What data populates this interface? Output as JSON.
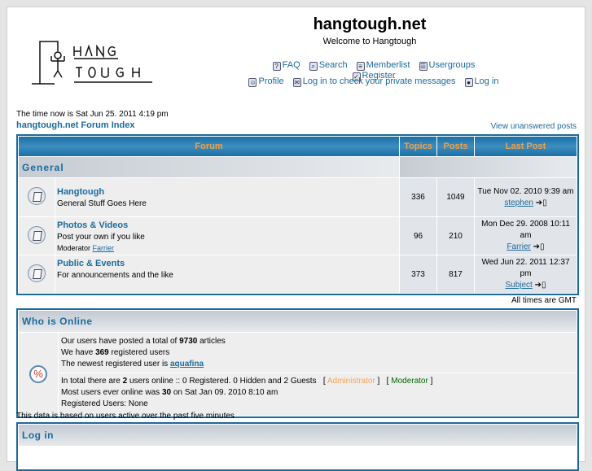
{
  "header": {
    "title": "hangtough.net",
    "subtitle": "Welcome to Hangtough",
    "logo_text": "HANG TOUGH"
  },
  "nav": {
    "row1": [
      {
        "icon": "faq-icon",
        "label": "FAQ"
      },
      {
        "icon": "search-icon",
        "label": "Search"
      },
      {
        "icon": "memberlist-icon",
        "label": "Memberlist"
      },
      {
        "icon": "usergroups-icon",
        "label": "Usergroups"
      },
      {
        "icon": "register-icon",
        "label": "Register"
      }
    ],
    "row2": [
      {
        "icon": "profile-icon",
        "label": "Profile"
      },
      {
        "icon": "messages-icon",
        "label": "Log in to check your private messages"
      },
      {
        "icon": "login-icon",
        "label": "Log in"
      }
    ]
  },
  "time_now": "The time now is Sat Jun 25. 2011 4:19 pm",
  "breadcrumb": "hangtough.net Forum Index",
  "view_unanswered": "View unanswered posts",
  "table": {
    "headers": [
      "Forum",
      "Topics",
      "Posts",
      "Last Post"
    ],
    "category": "General",
    "forums": [
      {
        "name": "Hangtough",
        "desc": "General Stuff Goes Here",
        "moderator_label": "",
        "moderator": "",
        "topics": "336",
        "posts": "1049",
        "last_date": "Tue Nov 02. 2010 9:39 am",
        "last_user": "stephen"
      },
      {
        "name": "Photos & Videos",
        "desc": "Post your own if you like",
        "moderator_label": "Moderator",
        "moderator": "Farrier",
        "topics": "96",
        "posts": "210",
        "last_date": "Mon Dec 29. 2008 10:11 am",
        "last_user": "Farrier"
      },
      {
        "name": "Public & Events",
        "desc": "For announcements and the like",
        "moderator_label": "",
        "moderator": "",
        "topics": "373",
        "posts": "817",
        "last_date": "Wed Jun 22. 2011 12:37 pm",
        "last_user": "Subject"
      }
    ]
  },
  "all_times": "All times are GMT",
  "online": {
    "title": "Who is Online",
    "l1a": "Our users have posted a total of ",
    "l1b": "9730",
    "l1c": " articles",
    "l2a": "We have ",
    "l2b": "369",
    "l2c": " registered users",
    "l3a": "The newest registered user is ",
    "l3b": "aquafina",
    "l4a": "In total there are ",
    "l4b": "2",
    "l4c": " users online :: 0 Registered. 0 Hidden and 2 Guests",
    "admin": "Administrator",
    "mod": "Moderator",
    "l5a": "Most users ever online was ",
    "l5b": "30",
    "l5c": " on Sat Jan 09. 2010 8:10 am",
    "l6": "Registered Users: None",
    "based": "This data is based on users active over the past five minutes",
    "colors": {
      "admin": "#ffa34f",
      "mod": "#006600"
    }
  },
  "login": {
    "title": "Log in"
  }
}
